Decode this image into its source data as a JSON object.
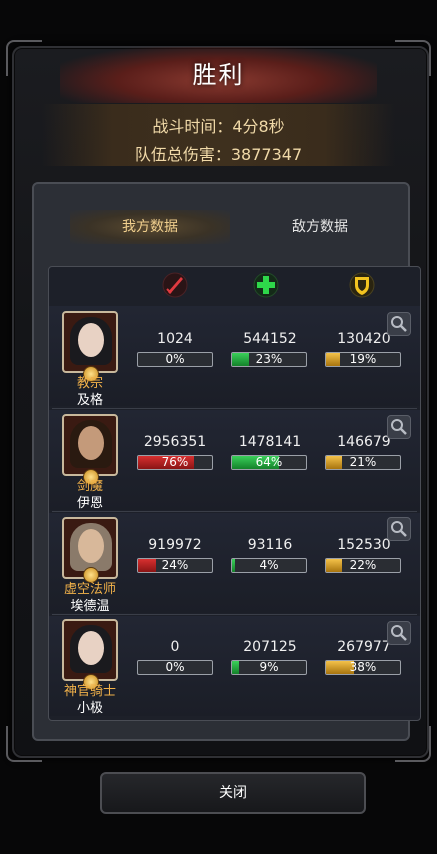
{
  "title": "胜利",
  "battle_time": "战斗时间：4分8秒",
  "total_damage": "队伍总伤害：3877347",
  "tabs": {
    "ours": "我方数据",
    "enemy": "敌方数据"
  },
  "columns": [
    {
      "icon": "damage-sword-icon",
      "color": "#d8333a"
    },
    {
      "icon": "healing-cross-icon",
      "color": "#2ed84a"
    },
    {
      "icon": "defense-shield-icon",
      "color": "#f2c320"
    }
  ],
  "heroes": [
    {
      "class": "教宗",
      "name": "及格",
      "damage": "1024",
      "damage_pct": "0%",
      "damage_frac": 0.0,
      "heal": "544152",
      "heal_pct": "23%",
      "heal_frac": 0.23,
      "tank": "130420",
      "tank_pct": "19%",
      "tank_frac": 0.19,
      "portrait": "female-dark-hair"
    },
    {
      "class": "剑魔",
      "name": "伊恩",
      "damage": "2956351",
      "damage_pct": "76%",
      "damage_frac": 0.76,
      "heal": "1478141",
      "heal_pct": "64%",
      "heal_frac": 0.64,
      "tank": "146679",
      "tank_pct": "21%",
      "tank_frac": 0.21,
      "portrait": "male-long-hair"
    },
    {
      "class": "虚空法师",
      "name": "埃德温",
      "damage": "919972",
      "damage_pct": "24%",
      "damage_frac": 0.24,
      "heal": "93116",
      "heal_pct": "4%",
      "heal_frac": 0.04,
      "tank": "152530",
      "tank_pct": "22%",
      "tank_frac": 0.22,
      "portrait": "old-bearded-mage"
    },
    {
      "class": "神官骑士",
      "name": "小极",
      "damage": "0",
      "damage_pct": "0%",
      "damage_frac": 0.0,
      "heal": "207125",
      "heal_pct": "9%",
      "heal_frac": 0.09,
      "tank": "267977",
      "tank_pct": "38%",
      "tank_frac": 0.38,
      "portrait": "female-dark-hair"
    }
  ],
  "close_label": "关闭"
}
